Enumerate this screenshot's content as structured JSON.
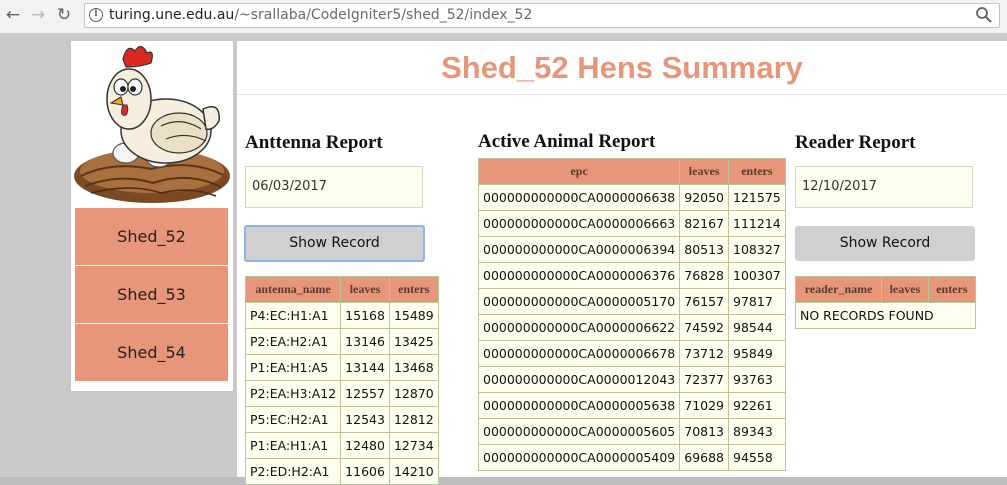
{
  "browser": {
    "url_host": "turing.une.edu.au",
    "url_path": "/~srallaba/CodeIgniter5/shed_52/index_52"
  },
  "sidebar": {
    "items": [
      {
        "label": "Shed_52"
      },
      {
        "label": "Shed_53"
      },
      {
        "label": "Shed_54"
      }
    ]
  },
  "main": {
    "title": "Shed_52 Hens Summary"
  },
  "antenna": {
    "heading": "Anttenna Report",
    "date": "06/03/2017",
    "button": "Show Record",
    "columns": [
      "antenna_name",
      "leaves",
      "enters"
    ],
    "rows": [
      [
        "P4:EC:H1:A1",
        "15168",
        "15489"
      ],
      [
        "P2:EA:H2:A1",
        "13146",
        "13425"
      ],
      [
        "P1:EA:H1:A5",
        "13144",
        "13468"
      ],
      [
        "P2:EA:H3:A12",
        "12557",
        "12870"
      ],
      [
        "P5:EC:H2:A1",
        "12543",
        "12812"
      ],
      [
        "P1:EA:H1:A1",
        "12480",
        "12734"
      ],
      [
        "P2:ED:H2:A1",
        "11606",
        "14210"
      ]
    ]
  },
  "active": {
    "heading": "Active Animal Report",
    "columns": [
      "epc",
      "leaves",
      "enters"
    ],
    "rows": [
      [
        "000000000000CA0000006638",
        "92050",
        "121575"
      ],
      [
        "000000000000CA0000006663",
        "82167",
        "111214"
      ],
      [
        "000000000000CA0000006394",
        "80513",
        "108327"
      ],
      [
        "000000000000CA0000006376",
        "76828",
        "100307"
      ],
      [
        "000000000000CA0000005170",
        "76157",
        "97817"
      ],
      [
        "000000000000CA0000006622",
        "74592",
        "98544"
      ],
      [
        "000000000000CA0000006678",
        "73712",
        "95849"
      ],
      [
        "000000000000CA0000012043",
        "72377",
        "93763"
      ],
      [
        "000000000000CA0000005638",
        "71029",
        "92261"
      ],
      [
        "000000000000CA0000005605",
        "70813",
        "89343"
      ],
      [
        "000000000000CA0000005409",
        "69688",
        "94558"
      ]
    ]
  },
  "reader": {
    "heading": "Reader Report",
    "date": "12/10/2017",
    "button": "Show Record",
    "columns": [
      "reader_name",
      "leaves",
      "enters"
    ],
    "empty_message": "NO RECORDS FOUND"
  },
  "colors": {
    "accent": "#e8967a",
    "cell_bg": "#fffff0",
    "page_bg": "#c9c9c9"
  }
}
